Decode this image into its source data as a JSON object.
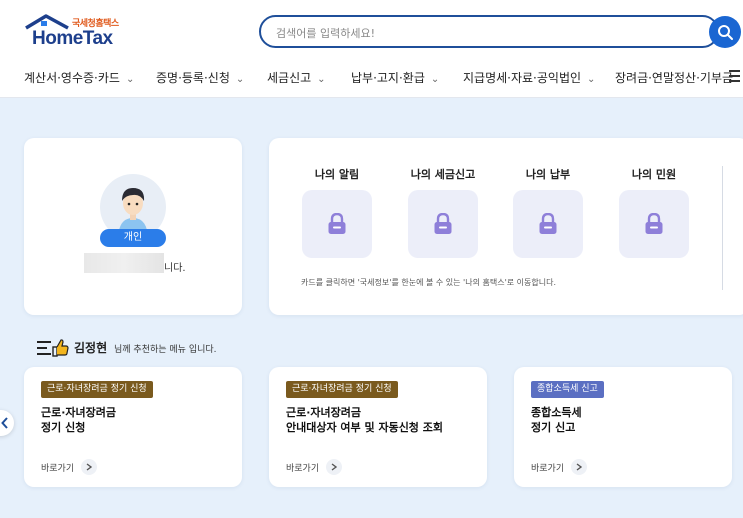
{
  "header": {
    "logo_small": "국세청홈택스",
    "logo_main": "HomeTax",
    "search_placeholder": "검색어를 입력하세요!"
  },
  "nav": [
    {
      "label": "계산서·영수증·카드"
    },
    {
      "label": "증명·등록·신청"
    },
    {
      "label": "세금신고"
    },
    {
      "label": "납부·고지·환급"
    },
    {
      "label": "지급명세·자료·공익법인"
    },
    {
      "label": "장려금·연말정산·기부금"
    }
  ],
  "profile": {
    "badge": "개인",
    "name_suffix": "니다."
  },
  "mine": {
    "items": [
      {
        "label": "나의 알림"
      },
      {
        "label": "나의 세금신고"
      },
      {
        "label": "나의 납부"
      },
      {
        "label": "나의 민원"
      }
    ],
    "note": "카드를 클릭하면 '국세정보'를 한눈에 볼 수 있는 '나의 홈택스'로 이동합니다."
  },
  "recommend": {
    "name": "김정현",
    "tail": "님께 추천하는 메뉴 입니다.",
    "cards": [
      {
        "tag": "근로·자녀장려금 정기 신청",
        "tag_color": "#7a5a1e",
        "title_line1": "근로·자녀장려금",
        "title_line2": "정기 신청",
        "go": "바로가기"
      },
      {
        "tag": "근로·자녀장려금 정기 신청",
        "tag_color": "#7a5a1e",
        "title_line1": "근로·자녀장려금",
        "title_line2": "안내대상자 여부 및 자동신청 조회",
        "go": "바로가기"
      },
      {
        "tag": "종합소득세 신고",
        "tag_color": "#5b6fc2",
        "title_line1": "종합소득세",
        "title_line2": "정기 신고",
        "go": "바로가기"
      }
    ]
  },
  "colors": {
    "brand_blue": "#1d3f8c",
    "accent_blue": "#2b7de9",
    "page_bg": "#e6f0fb",
    "lock_purple": "#8e7fd9"
  }
}
